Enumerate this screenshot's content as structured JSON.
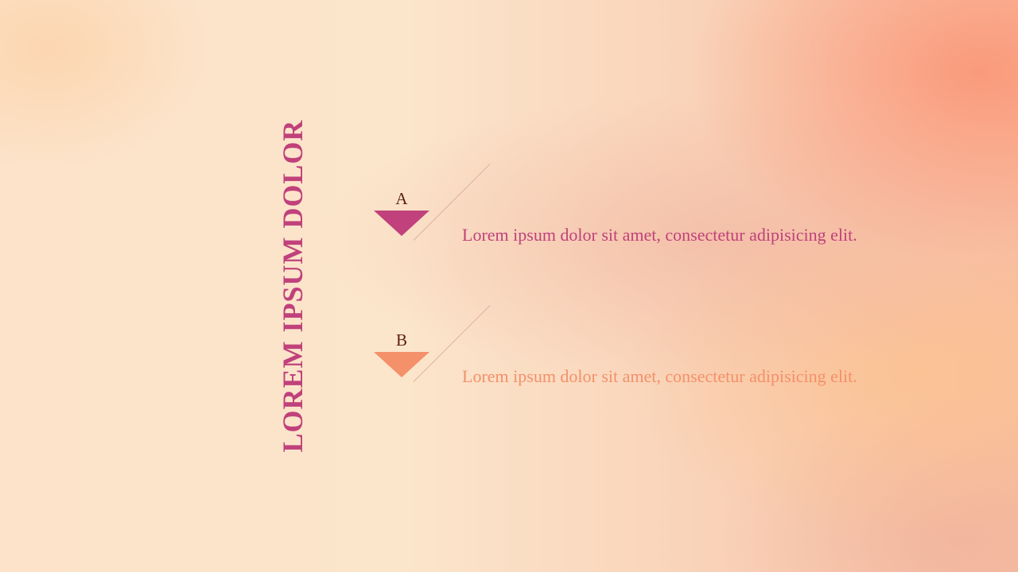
{
  "slide": {
    "title": "LOREM IPSUM DOLOR",
    "items": [
      {
        "letter": "A",
        "text": "Lorem ipsum dolor sit amet, consectetur adipisicing elit."
      },
      {
        "letter": "B",
        "text": "Lorem ipsum dolor sit amet, consectetur adipisicing elit."
      }
    ]
  },
  "colors": {
    "title": "#c0417b",
    "item_a": "#c0417b",
    "item_b": "#f4906a",
    "letter": "#5a1e10"
  }
}
